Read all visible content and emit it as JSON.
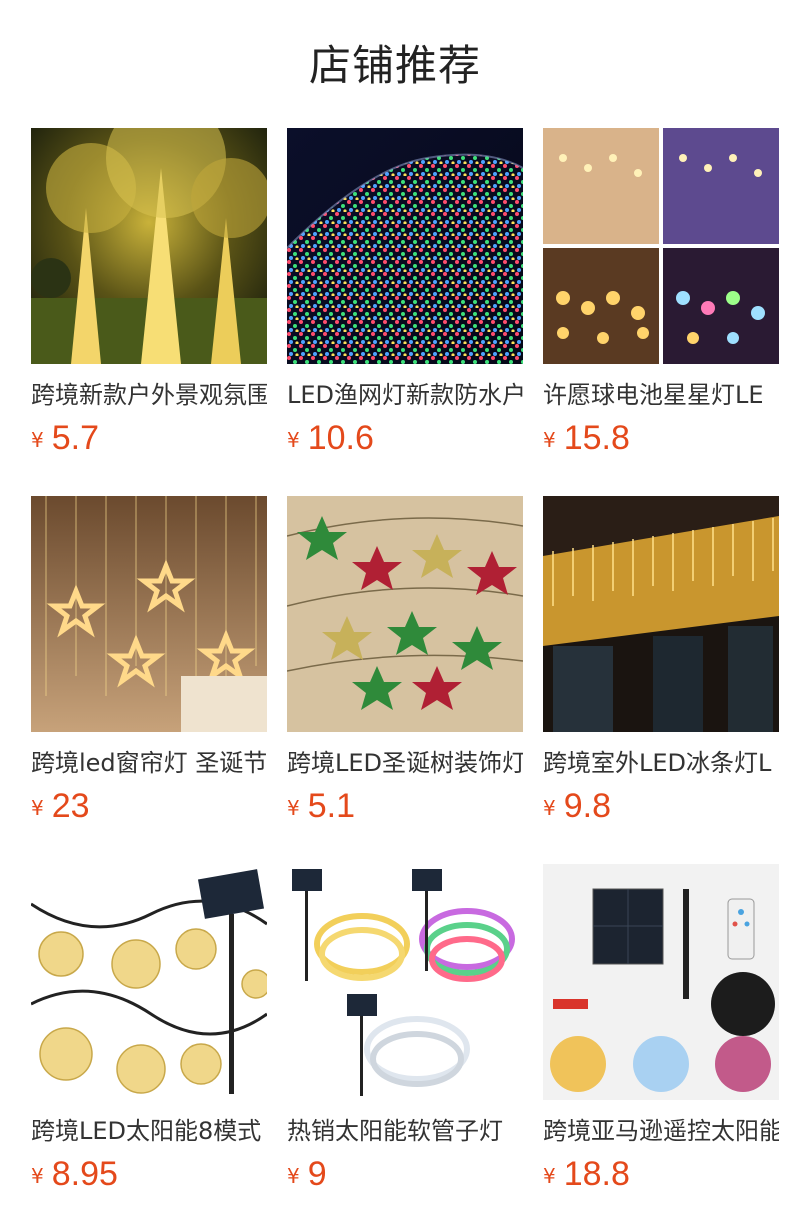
{
  "page": {
    "title": "店铺推荐"
  },
  "colors": {
    "price": "#e4491b",
    "text": "#333333",
    "background": "#ffffff"
  },
  "products": [
    {
      "name": "跨境新款户外景观氛围",
      "currency": "¥",
      "price": "5.7",
      "image": "glowing-trees-image"
    },
    {
      "name": "LED渔网灯新款防水户",
      "currency": "¥",
      "price": "10.6",
      "image": "net-lights-image"
    },
    {
      "name": "许愿球电池星星灯LE",
      "currency": "¥",
      "price": "15.8",
      "image": "star-curtain-image"
    },
    {
      "name": "跨境led窗帘灯 圣诞节",
      "currency": "¥",
      "price": "23",
      "image": "star-window-curtain-image"
    },
    {
      "name": "跨境LED圣诞树装饰灯",
      "currency": "¥",
      "price": "5.1",
      "image": "christmas-star-string-image"
    },
    {
      "name": "跨境室外LED冰条灯L",
      "currency": "¥",
      "price": "9.8",
      "image": "icicle-lights-image"
    },
    {
      "name": "跨境LED太阳能8模式",
      "currency": "¥",
      "price": "8.95",
      "image": "solar-globe-lights-image"
    },
    {
      "name": "热销太阳能软管子灯",
      "currency": "¥",
      "price": "9",
      "image": "solar-tube-lights-image"
    },
    {
      "name": "跨境亚马逊遥控太阳能",
      "currency": "¥",
      "price": "18.8",
      "image": "solar-remote-kit-image"
    }
  ]
}
